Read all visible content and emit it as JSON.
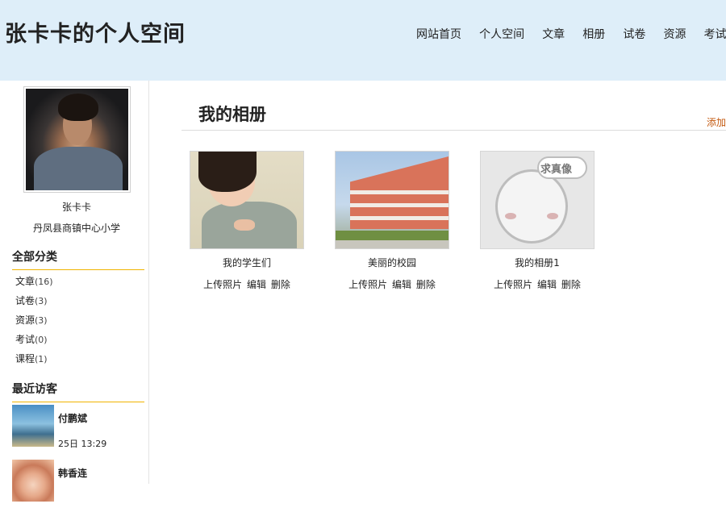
{
  "header": {
    "site_title": "张卡卡的个人空间",
    "nav": [
      "网站首页",
      "个人空间",
      "文章",
      "相册",
      "试卷",
      "资源",
      "考试"
    ]
  },
  "sidebar": {
    "user_name": "张卡卡",
    "school": "丹凤县商镇中心小学",
    "categories_title": "全部分类",
    "categories": [
      {
        "label": "文章",
        "count": "(16)"
      },
      {
        "label": "试卷",
        "count": "(3)"
      },
      {
        "label": "资源",
        "count": "(3)"
      },
      {
        "label": "考试",
        "count": "(0)"
      },
      {
        "label": "课程",
        "count": "(1)"
      }
    ],
    "visitors_title": "最近访客",
    "visitors": [
      {
        "name": "付鹏斌",
        "time": "25日 13:29"
      },
      {
        "name": "韩香连",
        "time": ""
      }
    ]
  },
  "main": {
    "title": "我的相册",
    "add_link": "添加",
    "albums": [
      {
        "name": "我的学生们",
        "actions": [
          "上传照片",
          "编辑",
          "删除"
        ]
      },
      {
        "name": "美丽的校园",
        "actions": [
          "上传照片",
          "编辑",
          "删除"
        ]
      },
      {
        "name": "我的相册1",
        "actions": [
          "上传照片",
          "编辑",
          "删除"
        ],
        "cover_text": "求真像"
      }
    ]
  }
}
